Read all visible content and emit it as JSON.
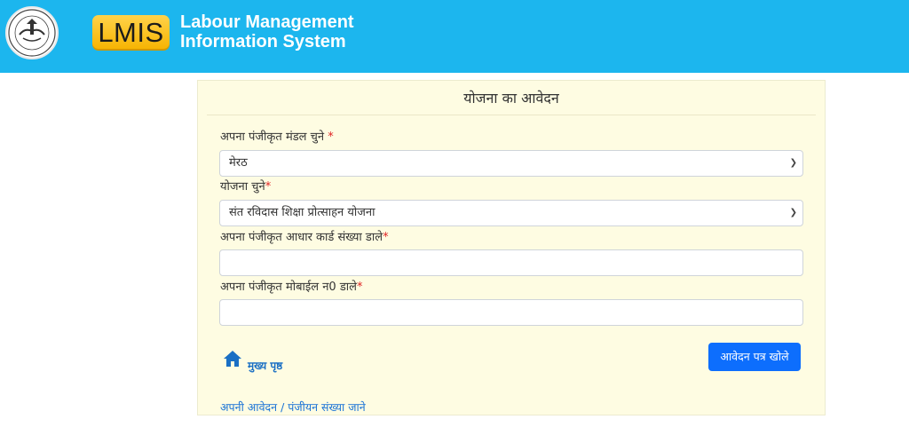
{
  "header": {
    "logo_text": "LMIS",
    "title_line1": "Labour Management",
    "title_line2": "Information System"
  },
  "form": {
    "title": "योजना का आवेदन",
    "mandal_label": "अपना पंजीकृत मंडल चुने",
    "mandal_required": " *",
    "mandal_value": "मेरठ",
    "yojana_label": "योजना चुने",
    "yojana_required": "*",
    "yojana_value": "संत रविदास शिक्षा प्रोत्साहन योजना",
    "aadhaar_label": "अपना पंजीकृत आधार कार्ड संख्या डाले",
    "aadhaar_required": "*",
    "aadhaar_value": "",
    "mobile_label": "अपना पंजीकृत मोबाईल न0 डाले",
    "mobile_required": "*",
    "mobile_value": "",
    "home_label": "मुख्य पृष्ठ",
    "submit_label": "आवेदन पत्र खोले",
    "status_link": "अपनी आवेदन / पंजीयन संख्या जाने"
  },
  "icons": {
    "emblem": "up-govt-emblem-icon",
    "home": "home-icon",
    "dropdown": "chevron-down-icon"
  },
  "colors": {
    "header_bg": "#1cb6ee",
    "card_bg": "#fefce2",
    "button_bg": "#0d6efd",
    "logo_bg": "#f6b300"
  }
}
